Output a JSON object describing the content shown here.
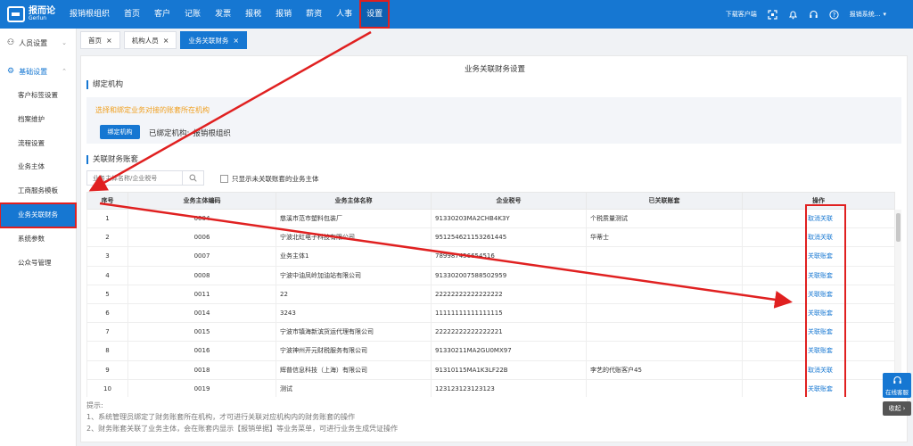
{
  "app": {
    "logo_cn": "报而论",
    "logo_en": "Gerlun",
    "nav": [
      "报销根组织",
      "首页",
      "客户",
      "记账",
      "发票",
      "报税",
      "报销",
      "薪资",
      "人事",
      "设置"
    ],
    "download_label": "下载客户端",
    "user_label": "报销系统..."
  },
  "sidebar": {
    "groups": [
      {
        "label": "人员设置"
      },
      {
        "label": "基础设置"
      }
    ],
    "items": [
      "客户标签设置",
      "档案维护",
      "流程设置",
      "业务主体",
      "工商服务模板",
      "业务关联财务",
      "系统参数",
      "公众号管理"
    ]
  },
  "tabs": [
    "首页",
    "机构人员",
    "业务关联财务"
  ],
  "page": {
    "title": "业务关联财务设置",
    "bind_section": "绑定机构",
    "bind_tip": "选择和绑定业务对接的账套所在机构",
    "bind_button": "绑定机构",
    "bound_label": "已绑定机构:",
    "bound_value": "报销根组织",
    "finance_section": "关联财务账套",
    "search_placeholder": "业务主体名称/企业税号",
    "filter_label": "只显示未关联账套的业务主体"
  },
  "table": {
    "headers": [
      "序号",
      "业务主体编码",
      "业务主体名称",
      "企业税号",
      "已关联账套",
      "操作"
    ],
    "rows": [
      {
        "no": "1",
        "code": "0004",
        "name": "慈溪市范市塑料包装厂",
        "tax": "91330203MA2CHB4K3Y",
        "account": "个税质量测试",
        "op": "取消关联"
      },
      {
        "no": "2",
        "code": "0006",
        "name": "宁波北虹电子科技有限公司",
        "tax": "951254621153261445",
        "account": "华蒂士",
        "op": "取消关联"
      },
      {
        "no": "3",
        "code": "0007",
        "name": "业务主体1",
        "tax": "789987456654516",
        "account": "",
        "op": "关联账套"
      },
      {
        "no": "4",
        "code": "0008",
        "name": "宁波中油凤岭加油站有限公司",
        "tax": "913302007588502959",
        "account": "",
        "op": "关联账套"
      },
      {
        "no": "5",
        "code": "0011",
        "name": "22",
        "tax": "22222222222222222",
        "account": "",
        "op": "关联账套"
      },
      {
        "no": "6",
        "code": "0014",
        "name": "3243",
        "tax": "11111111111111115",
        "account": "",
        "op": "关联账套"
      },
      {
        "no": "7",
        "code": "0015",
        "name": "宁波市镇海新滨货运代理有限公司",
        "tax": "22222222222222221",
        "account": "",
        "op": "关联账套"
      },
      {
        "no": "8",
        "code": "0016",
        "name": "宁波神州开元财税服务有限公司",
        "tax": "91330211MA2GU0MX97",
        "account": "",
        "op": "关联账套"
      },
      {
        "no": "9",
        "code": "0018",
        "name": "辉普信息科技（上海）有限公司",
        "tax": "91310115MA1K3LF22B",
        "account": "李艺的代账客户45",
        "op": "取消关联"
      },
      {
        "no": "10",
        "code": "0019",
        "name": "测试",
        "tax": "123123123123123",
        "account": "",
        "op": "关联账套"
      }
    ]
  },
  "notes": {
    "title": "提示:",
    "lines": [
      "1、系统管理员绑定了财务账套所在机构，才可进行关联对应机构内的财务账套的操作",
      "2、财务账套关联了业务主体，会在账套内显示【报销单据】等业务菜单，可进行业务生成凭证操作"
    ]
  },
  "float": {
    "service_label": "在线客服",
    "collapse_label": "收起"
  },
  "colors": {
    "primary": "#1677d2",
    "annotation": "#e02020",
    "tip": "#f0a020"
  }
}
